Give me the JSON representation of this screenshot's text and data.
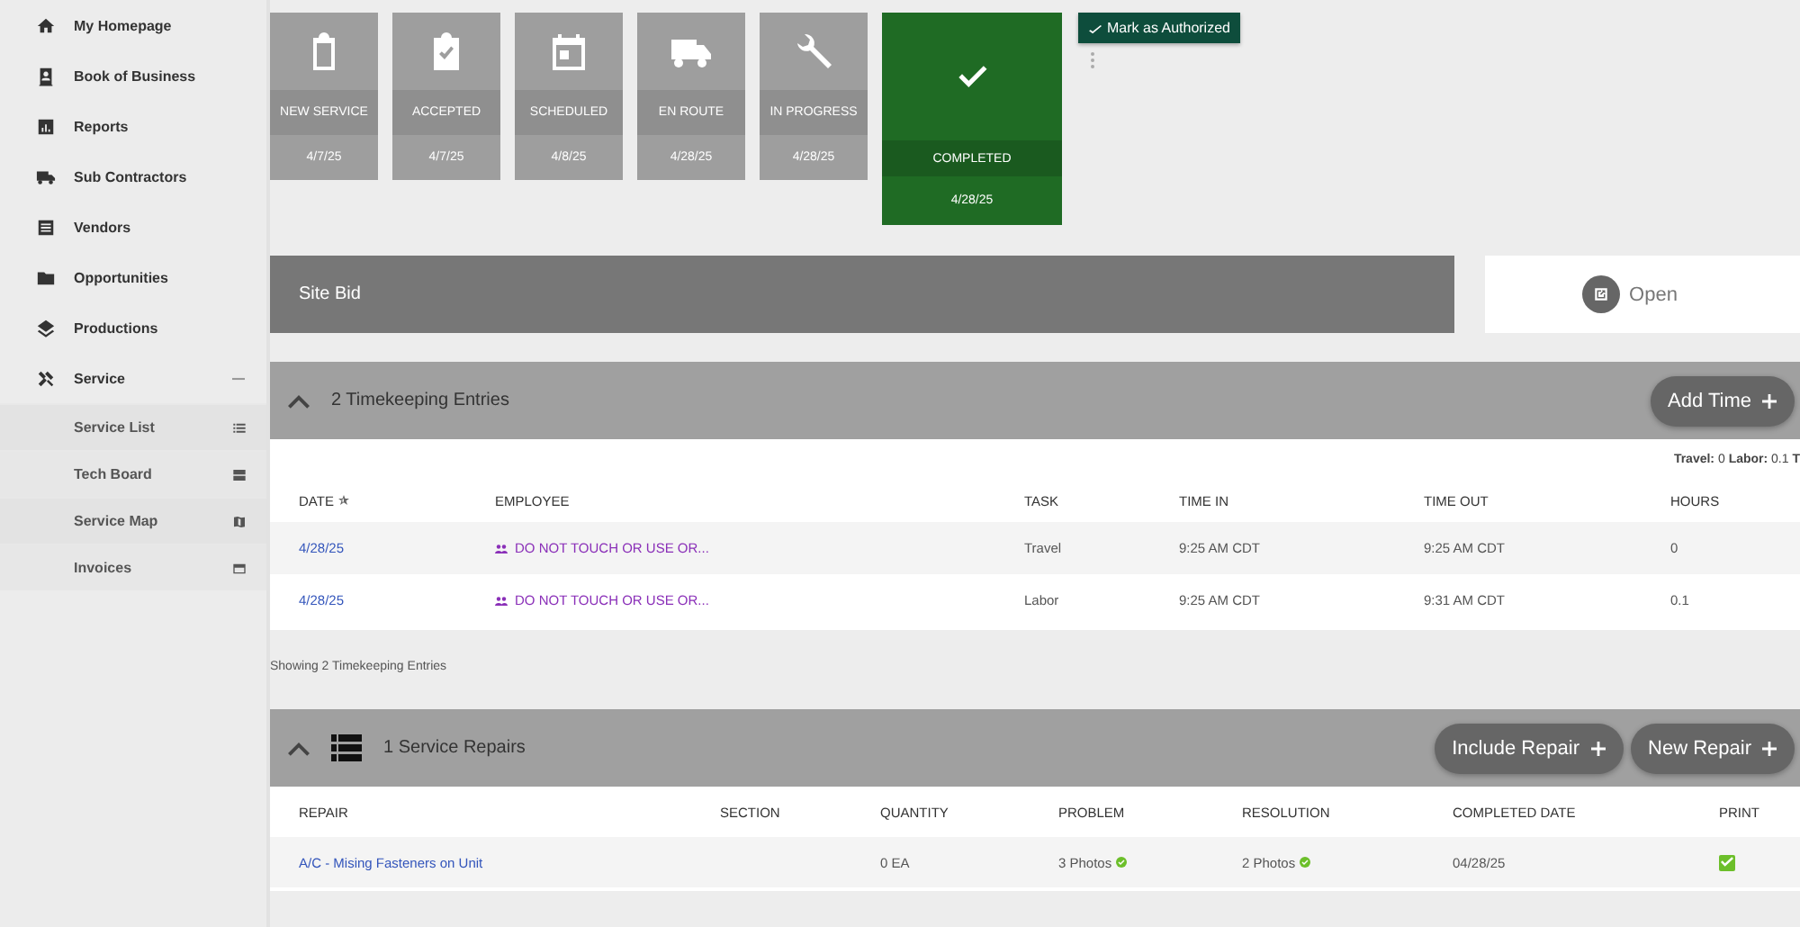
{
  "sidebar": {
    "items": [
      {
        "label": "My Homepage"
      },
      {
        "label": "Book of Business"
      },
      {
        "label": "Reports"
      },
      {
        "label": "Sub Contractors"
      },
      {
        "label": "Vendors"
      },
      {
        "label": "Opportunities"
      },
      {
        "label": "Productions"
      },
      {
        "label": "Service",
        "expanded": true,
        "children": [
          {
            "label": "Service List"
          },
          {
            "label": "Tech Board"
          },
          {
            "label": "Service Map"
          },
          {
            "label": "Invoices"
          }
        ]
      }
    ]
  },
  "status_steps": [
    {
      "label": "NEW SERVICE",
      "date": "4/7/25",
      "current": false
    },
    {
      "label": "ACCEPTED",
      "date": "4/7/25",
      "current": false
    },
    {
      "label": "SCHEDULED",
      "date": "4/8/25",
      "current": false
    },
    {
      "label": "EN ROUTE",
      "date": "4/28/25",
      "current": false
    },
    {
      "label": "IN PROGRESS",
      "date": "4/28/25",
      "current": false
    },
    {
      "label": "COMPLETED",
      "date": "4/28/25",
      "current": true
    }
  ],
  "authorize_button": "Mark as Authorized",
  "site_bid": {
    "title": "Site Bid",
    "open_button": "Open"
  },
  "timekeeping": {
    "title": "2 Timekeeping Entries",
    "expanded": true,
    "add_button": "Add Time",
    "totals": "**Travel:** 0 **Labor:** 0.1 **T**",
    "columns": [
      "DATE",
      "EMPLOYEE",
      "TASK",
      "TIME IN",
      "TIME OUT",
      "HOURS"
    ],
    "rows": [
      {
        "date": "4/28/25",
        "employee": "DO NOT TOUCH OR USE OR...",
        "task": "Travel",
        "time_in": "9:25 AM CDT",
        "time_out": "9:25 AM CDT",
        "hours": "0"
      },
      {
        "date": "4/28/25",
        "employee": "DO NOT TOUCH OR USE OR...",
        "task": "Labor",
        "time_in": "9:25 AM CDT",
        "time_out": "9:31 AM CDT",
        "hours": "0.1"
      }
    ],
    "footer": "Showing 2 Timekeeping Entries"
  },
  "repairs": {
    "title": "1 Service Repairs",
    "expanded": true,
    "buttons": [
      "Include Repair",
      "New Repair"
    ],
    "columns": [
      "REPAIR",
      "SECTION",
      "QUANTITY",
      "PROBLEM",
      "RESOLUTION",
      "COMPLETED DATE",
      "PRINT"
    ],
    "rows": [
      {
        "repair": "A/C - Mising Fasteners on Unit",
        "quantity": "0 EA",
        "problem": "3 Photos",
        "resolution": "2 Photos",
        "completed_date": "04/28/25",
        "print": true
      }
    ]
  }
}
